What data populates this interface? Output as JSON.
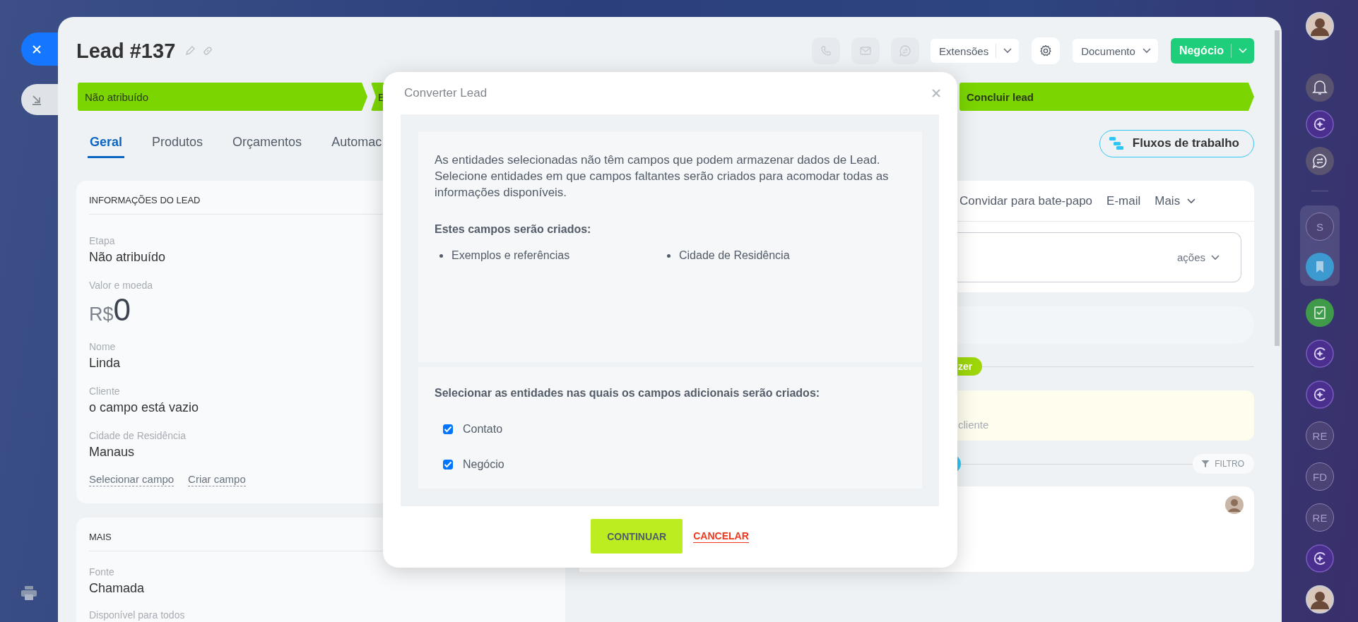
{
  "title": "Lead #137",
  "toolbar_buttons": [
    {
      "label": "Extensões",
      "kind": "split"
    },
    {
      "label": "Documento",
      "kind": "dropdown"
    },
    {
      "label": "Negócio",
      "kind": "primary_split"
    }
  ],
  "stages": [
    {
      "label": "Não atribuído"
    },
    {
      "label": "E"
    },
    {
      "label": "Concluir lead"
    }
  ],
  "tabs": [
    {
      "label": "Geral",
      "selected": true
    },
    {
      "label": "Produtos",
      "selected": false
    },
    {
      "label": "Orçamentos",
      "selected": false
    },
    {
      "label": "Automac",
      "selected": false
    }
  ],
  "workflow_button": "Fluxos de trabalho",
  "lead_card": {
    "title": "INFORMAÇÕES DO LEAD",
    "fields": [
      {
        "label": "Etapa",
        "value": "Não atribuído"
      },
      {
        "label": "Valor e moeda",
        "currency": "R$",
        "value": "0"
      },
      {
        "label": "Nome",
        "value": "Linda"
      },
      {
        "label": "Cliente",
        "value": "o campo está vazio"
      },
      {
        "label": "Cidade de Residência",
        "value": "Manaus"
      }
    ],
    "links": [
      "Selecionar campo",
      "Criar campo"
    ]
  },
  "more_card": {
    "title": "MAIS",
    "fields": [
      {
        "label": "Fonte",
        "value": "Chamada"
      },
      {
        "label": "Disponível para todos"
      }
    ]
  },
  "activity": {
    "tabs": [
      {
        "label": "Convidar para bate-papo",
        "kind": "plain"
      },
      {
        "label": "E-mail",
        "kind": "plain"
      },
      {
        "label": "Mais",
        "kind": "dropdown"
      }
    ],
    "editor_action": "ações",
    "tag": "zer",
    "hint": "cliente",
    "filter": "FILTRO"
  },
  "modal": {
    "title": "Converter Lead",
    "message": "As entidades selecionadas não têm campos que podem armazenar dados de Lead. Selecione entidades em que campos faltantes serão criados para acomodar todas as informações disponíveis.",
    "fields_heading": "Estes campos serão criados:",
    "fields": [
      "Exemplos e referências",
      "Cidade de Residência"
    ],
    "entities_heading": "Selecionar as entidades nas quais os campos adicionais serão criados:",
    "entities": [
      {
        "label": "Contato",
        "checked": true
      },
      {
        "label": "Negócio",
        "checked": true
      }
    ],
    "buttons": [
      {
        "label": "CONTINUAR",
        "kind": "primary"
      },
      {
        "label": "CANCELAR",
        "kind": "cancel"
      }
    ]
  },
  "right_rail": {
    "top": [
      {
        "kind": "photo"
      },
      {
        "kind": "bell"
      },
      {
        "kind": "copilot"
      },
      {
        "kind": "chat"
      }
    ],
    "pinned": [
      {
        "kind": "initials",
        "label": "S"
      },
      {
        "kind": "bookmark"
      }
    ],
    "items": [
      {
        "kind": "tasks"
      },
      {
        "kind": "copilot"
      },
      {
        "kind": "copilot"
      },
      {
        "kind": "initials",
        "label": "RE"
      },
      {
        "kind": "initials",
        "label": "FD"
      },
      {
        "kind": "initials",
        "label": "RE"
      },
      {
        "kind": "copilot"
      },
      {
        "kind": "photo"
      }
    ]
  }
}
